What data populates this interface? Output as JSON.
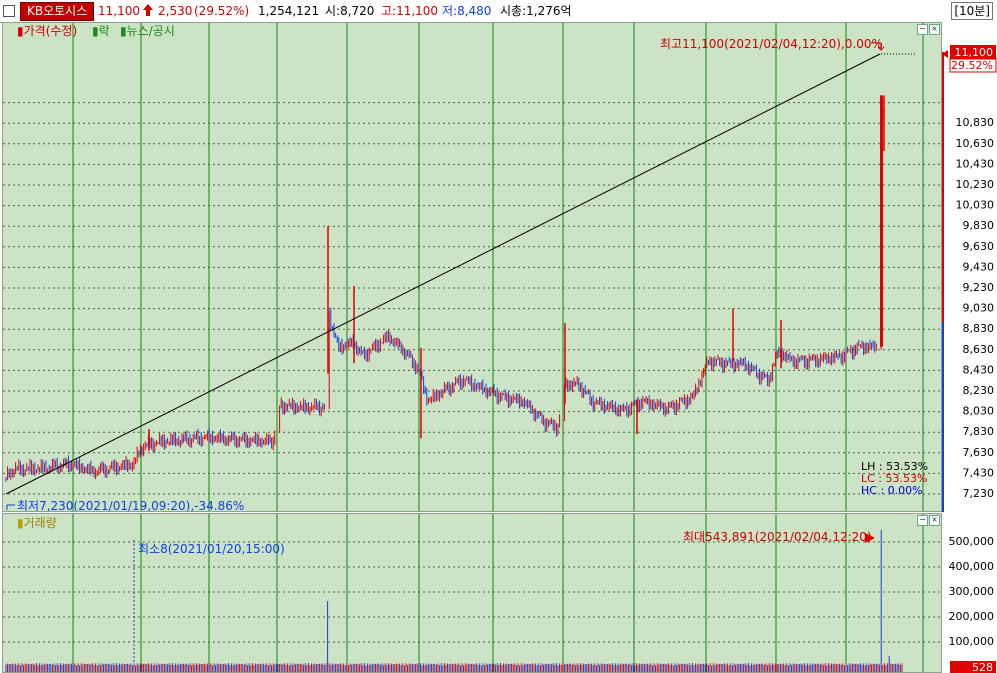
{
  "topbar": {
    "stock_name": "KB오토시스",
    "price": "11,100",
    "change_arrow": "arrow-up-icon",
    "change": "2,530",
    "change_pct": "(29.52%)",
    "volume": "1,254,121",
    "open": "시:8,720",
    "high": "고:11,100",
    "low": "저:8,480",
    "market_cap": "시총:1,276억",
    "interval": "[10분]"
  },
  "price_panel": {
    "legend": [
      "가격(수정)",
      "락",
      "뉴스/공시"
    ],
    "high_annotation": "최고11,100(2021/02/04,12:20),0.00%",
    "low_annotation": "최저7,230(2021/01/19,09:20),-34.86%",
    "stats": [
      {
        "label": "LH",
        "value": "53.53%",
        "color": "#000000"
      },
      {
        "label": "LC",
        "value": "53.53%",
        "color": "#cc0000"
      },
      {
        "label": "HC",
        "value": "0.00%",
        "color": "#0000cc"
      }
    ],
    "axis_ticks": [
      "10,830",
      "10,630",
      "10,430",
      "10,230",
      "10,030",
      "9,830",
      "9,630",
      "9,430",
      "9,230",
      "9,030",
      "8,830",
      "8,630",
      "8,430",
      "8,230",
      "8,030",
      "7,830",
      "7,630",
      "7,430",
      "7,230"
    ],
    "current_price_label": "11,100",
    "current_pct_label": "29.52%"
  },
  "volume_panel": {
    "legend": [
      "거래량"
    ],
    "min_annotation": "최소8(2021/01/20,15:00)",
    "max_annotation": "최대543,891(2021/02/04,12:20)",
    "axis_ticks": [
      "500,000",
      "400,000",
      "300,000",
      "200,000",
      "100,000"
    ],
    "current_label": "528"
  },
  "colors": {
    "up": "#e00000",
    "down": "#1040e0",
    "panel_bg": "#cde3c6",
    "grid_v": "#0a8a0a",
    "grid_h": "#3a6a3a"
  },
  "chart_data": {
    "type": "line",
    "title": "",
    "price_range": [
      7230,
      11100
    ],
    "volume_range": [
      0,
      543891
    ],
    "key_points": [
      {
        "label": "최저",
        "date": "2021/01/19,09:20",
        "value": 7230
      },
      {
        "label": "최고",
        "date": "2021/02/04,12:20",
        "value": 11100
      }
    ],
    "trendline": {
      "from": 7230,
      "to": 11100
    }
  }
}
